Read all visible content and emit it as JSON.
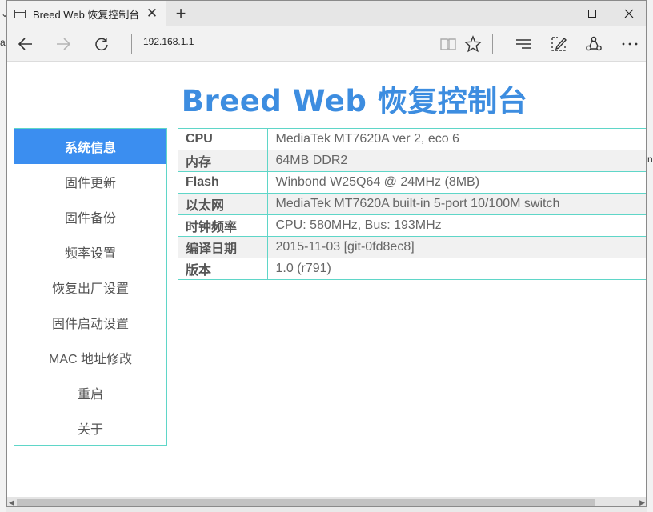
{
  "browser": {
    "tab_title": "Breed Web 恢复控制台",
    "address": "192.168.1.1"
  },
  "page": {
    "title": "Breed Web 恢复控制台"
  },
  "menu": {
    "items": [
      {
        "label": "系统信息",
        "active": true
      },
      {
        "label": "固件更新",
        "active": false
      },
      {
        "label": "固件备份",
        "active": false
      },
      {
        "label": "频率设置",
        "active": false
      },
      {
        "label": "恢复出厂设置",
        "active": false
      },
      {
        "label": "固件启动设置",
        "active": false
      },
      {
        "label": "MAC 地址修改",
        "active": false
      },
      {
        "label": "重启",
        "active": false
      },
      {
        "label": "关于",
        "active": false
      }
    ]
  },
  "info": {
    "rows": [
      {
        "key": "CPU",
        "value": "MediaTek MT7620A ver 2, eco 6"
      },
      {
        "key": "内存",
        "value": "64MB DDR2"
      },
      {
        "key": "Flash",
        "value": "Winbond W25Q64 @ 24MHz (8MB)"
      },
      {
        "key": "以太网",
        "value": "MediaTek MT7620A built-in 5-port 10/100M switch"
      },
      {
        "key": "时钟频率",
        "value": "CPU: 580MHz, Bus: 193MHz"
      },
      {
        "key": "编译日期",
        "value": "2015-11-03 [git-0fd8ec8]"
      },
      {
        "key": "版本",
        "value": "1.0 (r791)"
      }
    ]
  },
  "colors": {
    "title_blue": "#3d8de0",
    "active_menu_bg": "#3b8ef0",
    "border_teal": "#5fd6c8"
  }
}
